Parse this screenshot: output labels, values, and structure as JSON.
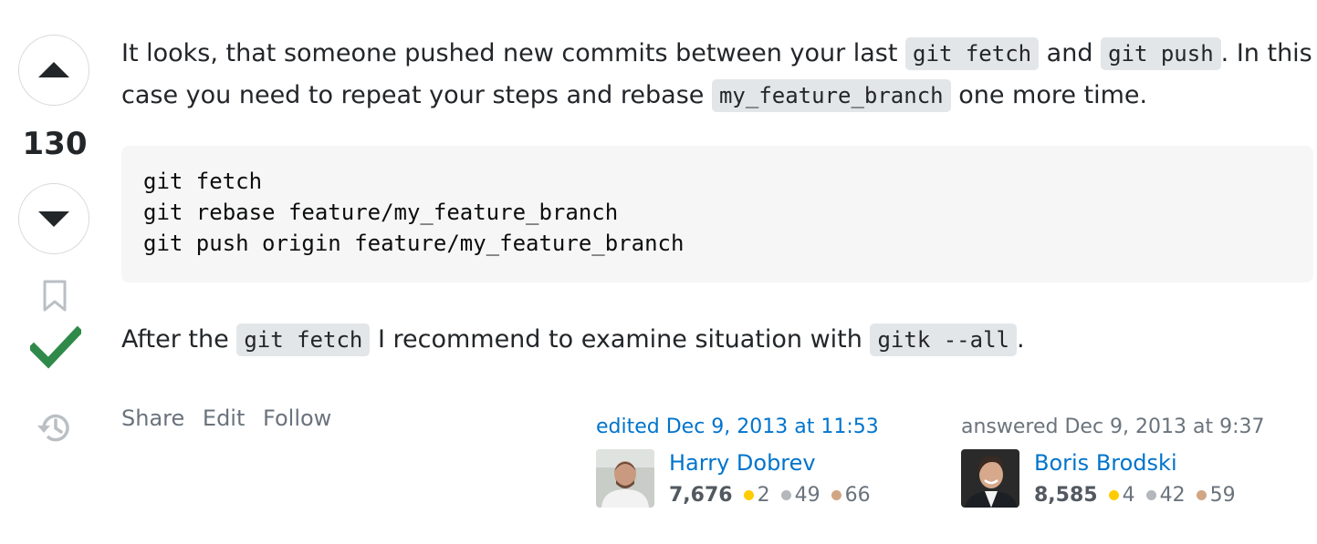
{
  "vote": {
    "count": "130"
  },
  "post": {
    "para1": {
      "t1": "It looks, that someone pushed new commits between your last ",
      "c1": "git fetch",
      "t2": " and ",
      "c2": "git push",
      "t3": ". In this case you need to repeat your steps and rebase ",
      "c3": "my_feature_branch",
      "t4": " one more time."
    },
    "code_lines": [
      "git fetch",
      "git rebase feature/my_feature_branch",
      "git push origin feature/my_feature_branch"
    ],
    "para2": {
      "t1": "After the ",
      "c1": "git fetch",
      "t2": " I recommend to examine situation with ",
      "c2": "gitk --all",
      "t3": "."
    }
  },
  "menu": {
    "share": "Share",
    "edit": "Edit",
    "follow": "Follow"
  },
  "editor": {
    "action": "edited Dec 9, 2013 at 11:53",
    "name": "Harry Dobrev",
    "reputation": "7,676",
    "gold": "2",
    "silver": "49",
    "bronze": "66"
  },
  "owner": {
    "action": "answered Dec 9, 2013 at 9:37",
    "name": "Boris Brodski",
    "reputation": "8,585",
    "gold": "4",
    "silver": "42",
    "bronze": "59"
  },
  "colors": {
    "accent": "#0074cc",
    "accepted": "#2f8a4a",
    "code_bg": "#e3e6e8"
  }
}
